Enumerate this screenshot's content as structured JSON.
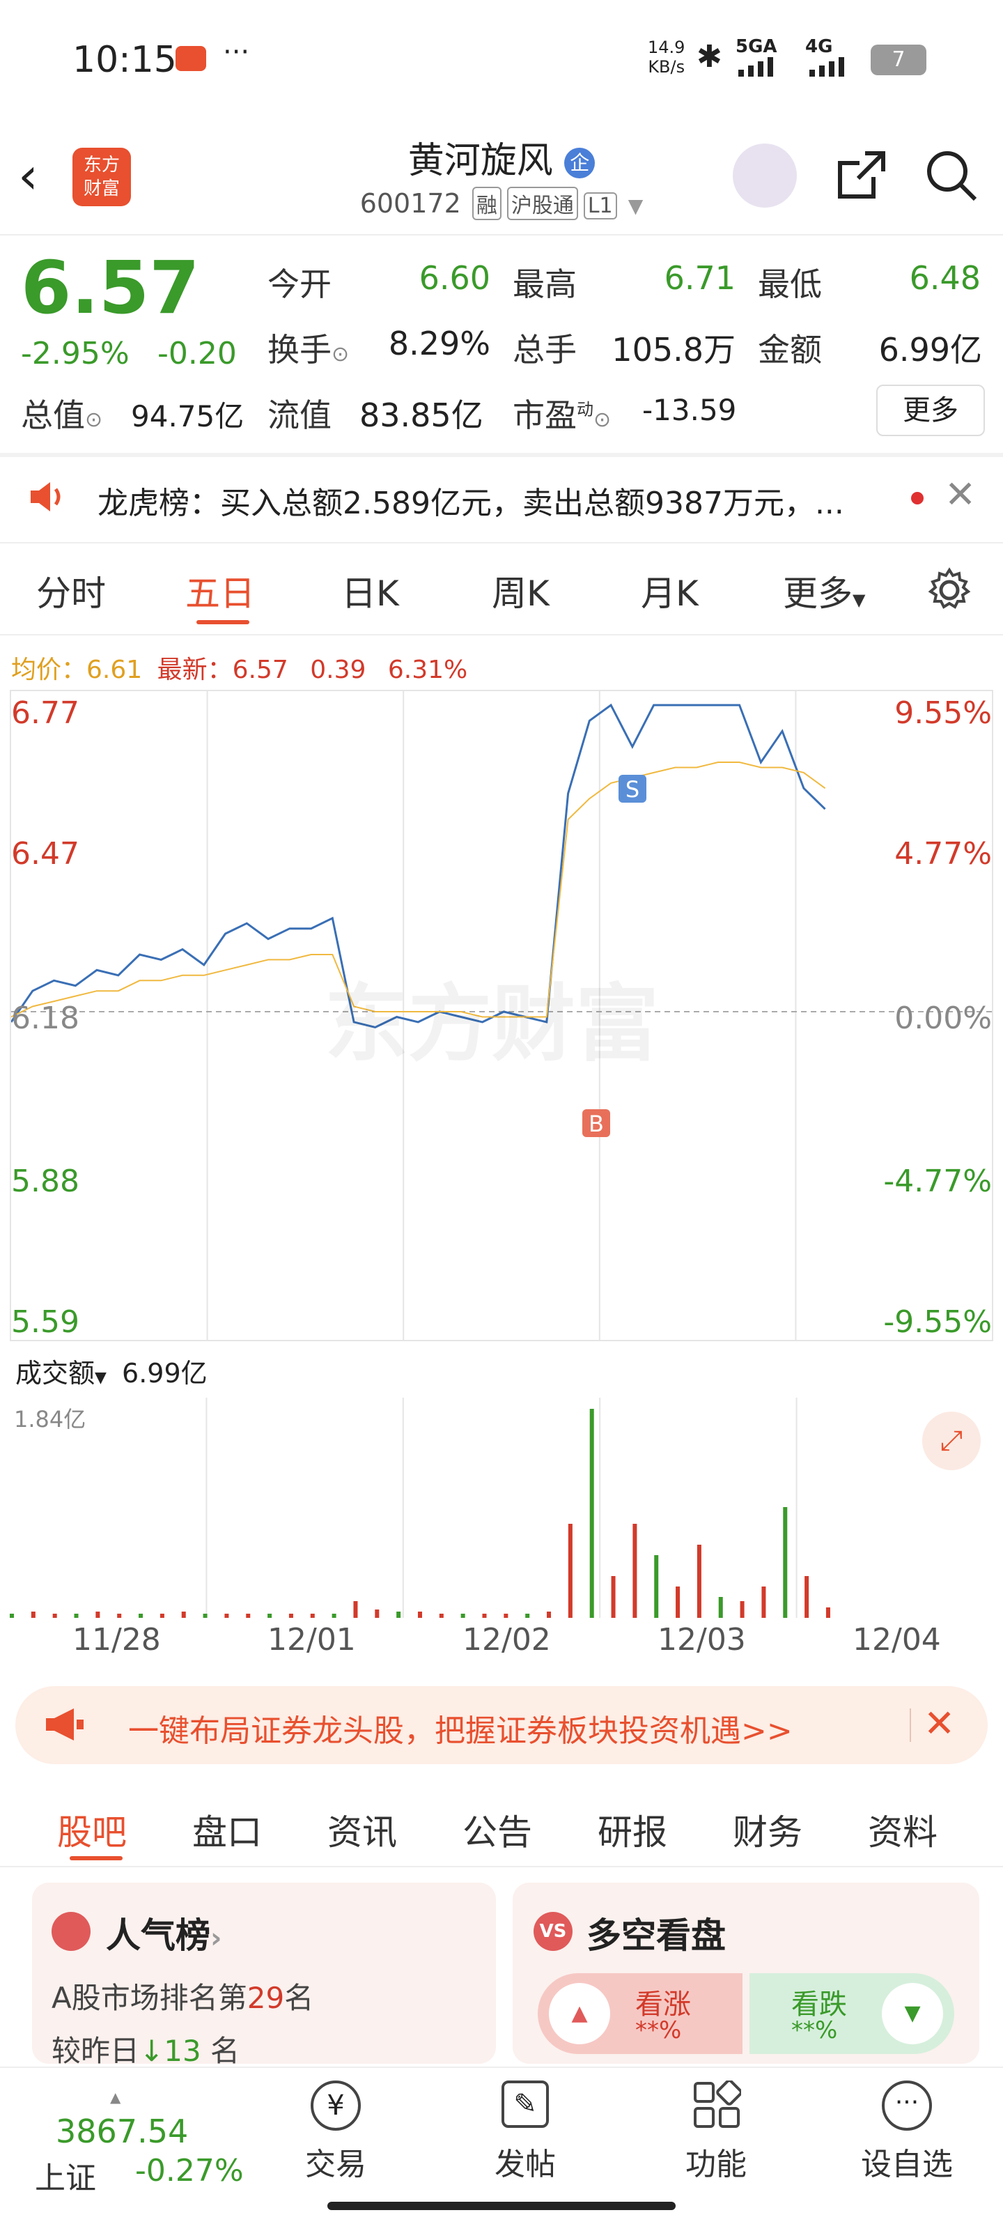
{
  "status_bar": {
    "time": "10:15",
    "net_speed": "14.9\nKB/s",
    "net_speed_top": "14.9",
    "net_speed_unit": "KB/s",
    "signal1": "5GA",
    "signal2": "4G",
    "battery": "7"
  },
  "header": {
    "logo_text": "东方财富",
    "title": "黄河旋风",
    "code": "600172",
    "tags": [
      "融",
      "沪股通",
      "L1"
    ]
  },
  "quote": {
    "price": "6.57",
    "change_pct": "-2.95%",
    "change": "-0.20",
    "open_label": "今开",
    "open": "6.60",
    "high_label": "最高",
    "high": "6.71",
    "low_label": "最低",
    "low": "6.48",
    "turnover_label": "换手",
    "turnover": "8.29%",
    "volume_label": "总手",
    "volume": "105.8万",
    "amount_label": "金额",
    "amount": "6.99亿",
    "mcap_label": "总值",
    "mcap": "94.75亿",
    "float_label": "流值",
    "float_mcap": "83.85亿",
    "pe_label": "市盈",
    "pe_sup": "动",
    "pe": "-13.59",
    "more": "更多"
  },
  "notice": {
    "text": "龙虎榜：买入总额2.589亿元，卖出总额9387万元，..."
  },
  "chart_tabs": [
    "分时",
    "五日",
    "日K",
    "周K",
    "月K",
    "更多"
  ],
  "chart_tab_active": "五日",
  "chart_info": {
    "avg_label": "均价：",
    "avg": "6.61",
    "latest_label": "最新：",
    "latest": "6.57",
    "chg": "0.39",
    "chg_pct": "6.31%"
  },
  "chart_data": {
    "type": "line",
    "title": "",
    "x": [
      "11/28",
      "12/01",
      "12/02",
      "12/03",
      "12/04"
    ],
    "ylim": [
      5.59,
      6.77
    ],
    "y_ticks_left": [
      "6.77",
      "6.47",
      "6.18",
      "5.88",
      "5.59"
    ],
    "y_ticks_right": [
      "9.55%",
      "4.77%",
      "0.00%",
      "-4.77%",
      "-9.55%"
    ],
    "series": [
      {
        "name": "",
        "values": [
          6.16,
          6.22,
          6.24,
          6.23,
          6.26,
          6.25,
          6.29,
          6.28,
          6.3,
          6.27,
          6.33,
          6.35,
          6.32,
          6.34,
          6.34,
          6.36,
          6.16,
          6.15,
          6.17,
          6.16,
          6.18,
          6.17,
          6.16,
          6.18,
          6.17,
          6.16,
          6.6,
          6.74,
          6.77,
          6.69,
          6.77,
          6.77,
          6.77,
          6.77,
          6.77,
          6.66,
          6.72,
          6.61,
          6.57
        ]
      },
      {
        "name": "",
        "values": [
          6.17,
          6.19,
          6.2,
          6.21,
          6.22,
          6.22,
          6.24,
          6.24,
          6.25,
          6.25,
          6.26,
          6.27,
          6.28,
          6.28,
          6.29,
          6.29,
          6.19,
          6.18,
          6.18,
          6.18,
          6.18,
          6.18,
          6.17,
          6.17,
          6.17,
          6.17,
          6.55,
          6.59,
          6.62,
          6.63,
          6.64,
          6.65,
          6.65,
          6.66,
          6.66,
          6.65,
          6.65,
          6.64,
          6.61
        ]
      }
    ],
    "markers": [
      "B",
      "S"
    ],
    "watermark": "东方财富",
    "grid": true
  },
  "volume": {
    "label": "成交额",
    "value": "6.99亿",
    "max": "1.84亿",
    "bars_relative": [
      0.02,
      0.03,
      0.02,
      0.02,
      0.03,
      0.02,
      0.02,
      0.02,
      0.03,
      0.02,
      0.02,
      0.02,
      0.02,
      0.02,
      0.02,
      0.02,
      0.08,
      0.04,
      0.03,
      0.03,
      0.02,
      0.02,
      0.02,
      0.02,
      0.02,
      0.03,
      0.45,
      1.0,
      0.2,
      0.45,
      0.3,
      0.15,
      0.35,
      0.1,
      0.08,
      0.15,
      0.53,
      0.2,
      0.05
    ]
  },
  "ad_banner": {
    "text": "一键布局证券龙头股，把握证券板块投资机遇>>"
  },
  "section_tabs": [
    "股吧",
    "盘口",
    "资讯",
    "公告",
    "研报",
    "财务",
    "资料"
  ],
  "section_tab_active": "股吧",
  "rank_card": {
    "title": "人气榜",
    "line1_prefix": "A股市场排名第",
    "rank": "29",
    "line1_suffix": "名",
    "line2_prefix": "较昨日",
    "change": "13",
    "line2_suffix": "名"
  },
  "vote_card": {
    "title": "多空看盘",
    "up_label": "看涨",
    "up_pct": "**%",
    "down_label": "看跌",
    "down_pct": "**%"
  },
  "bottom_bar": {
    "index_value": "3867.54",
    "index_name": "上证",
    "index_change": "-0.27%",
    "items": [
      "交易",
      "发帖",
      "功能",
      "设自选"
    ]
  },
  "colors": {
    "green": "#3a9a2a",
    "red": "#d23a2a",
    "orange": "#e8502f",
    "line": "#3a6fb5",
    "avg": "#f0b940"
  }
}
